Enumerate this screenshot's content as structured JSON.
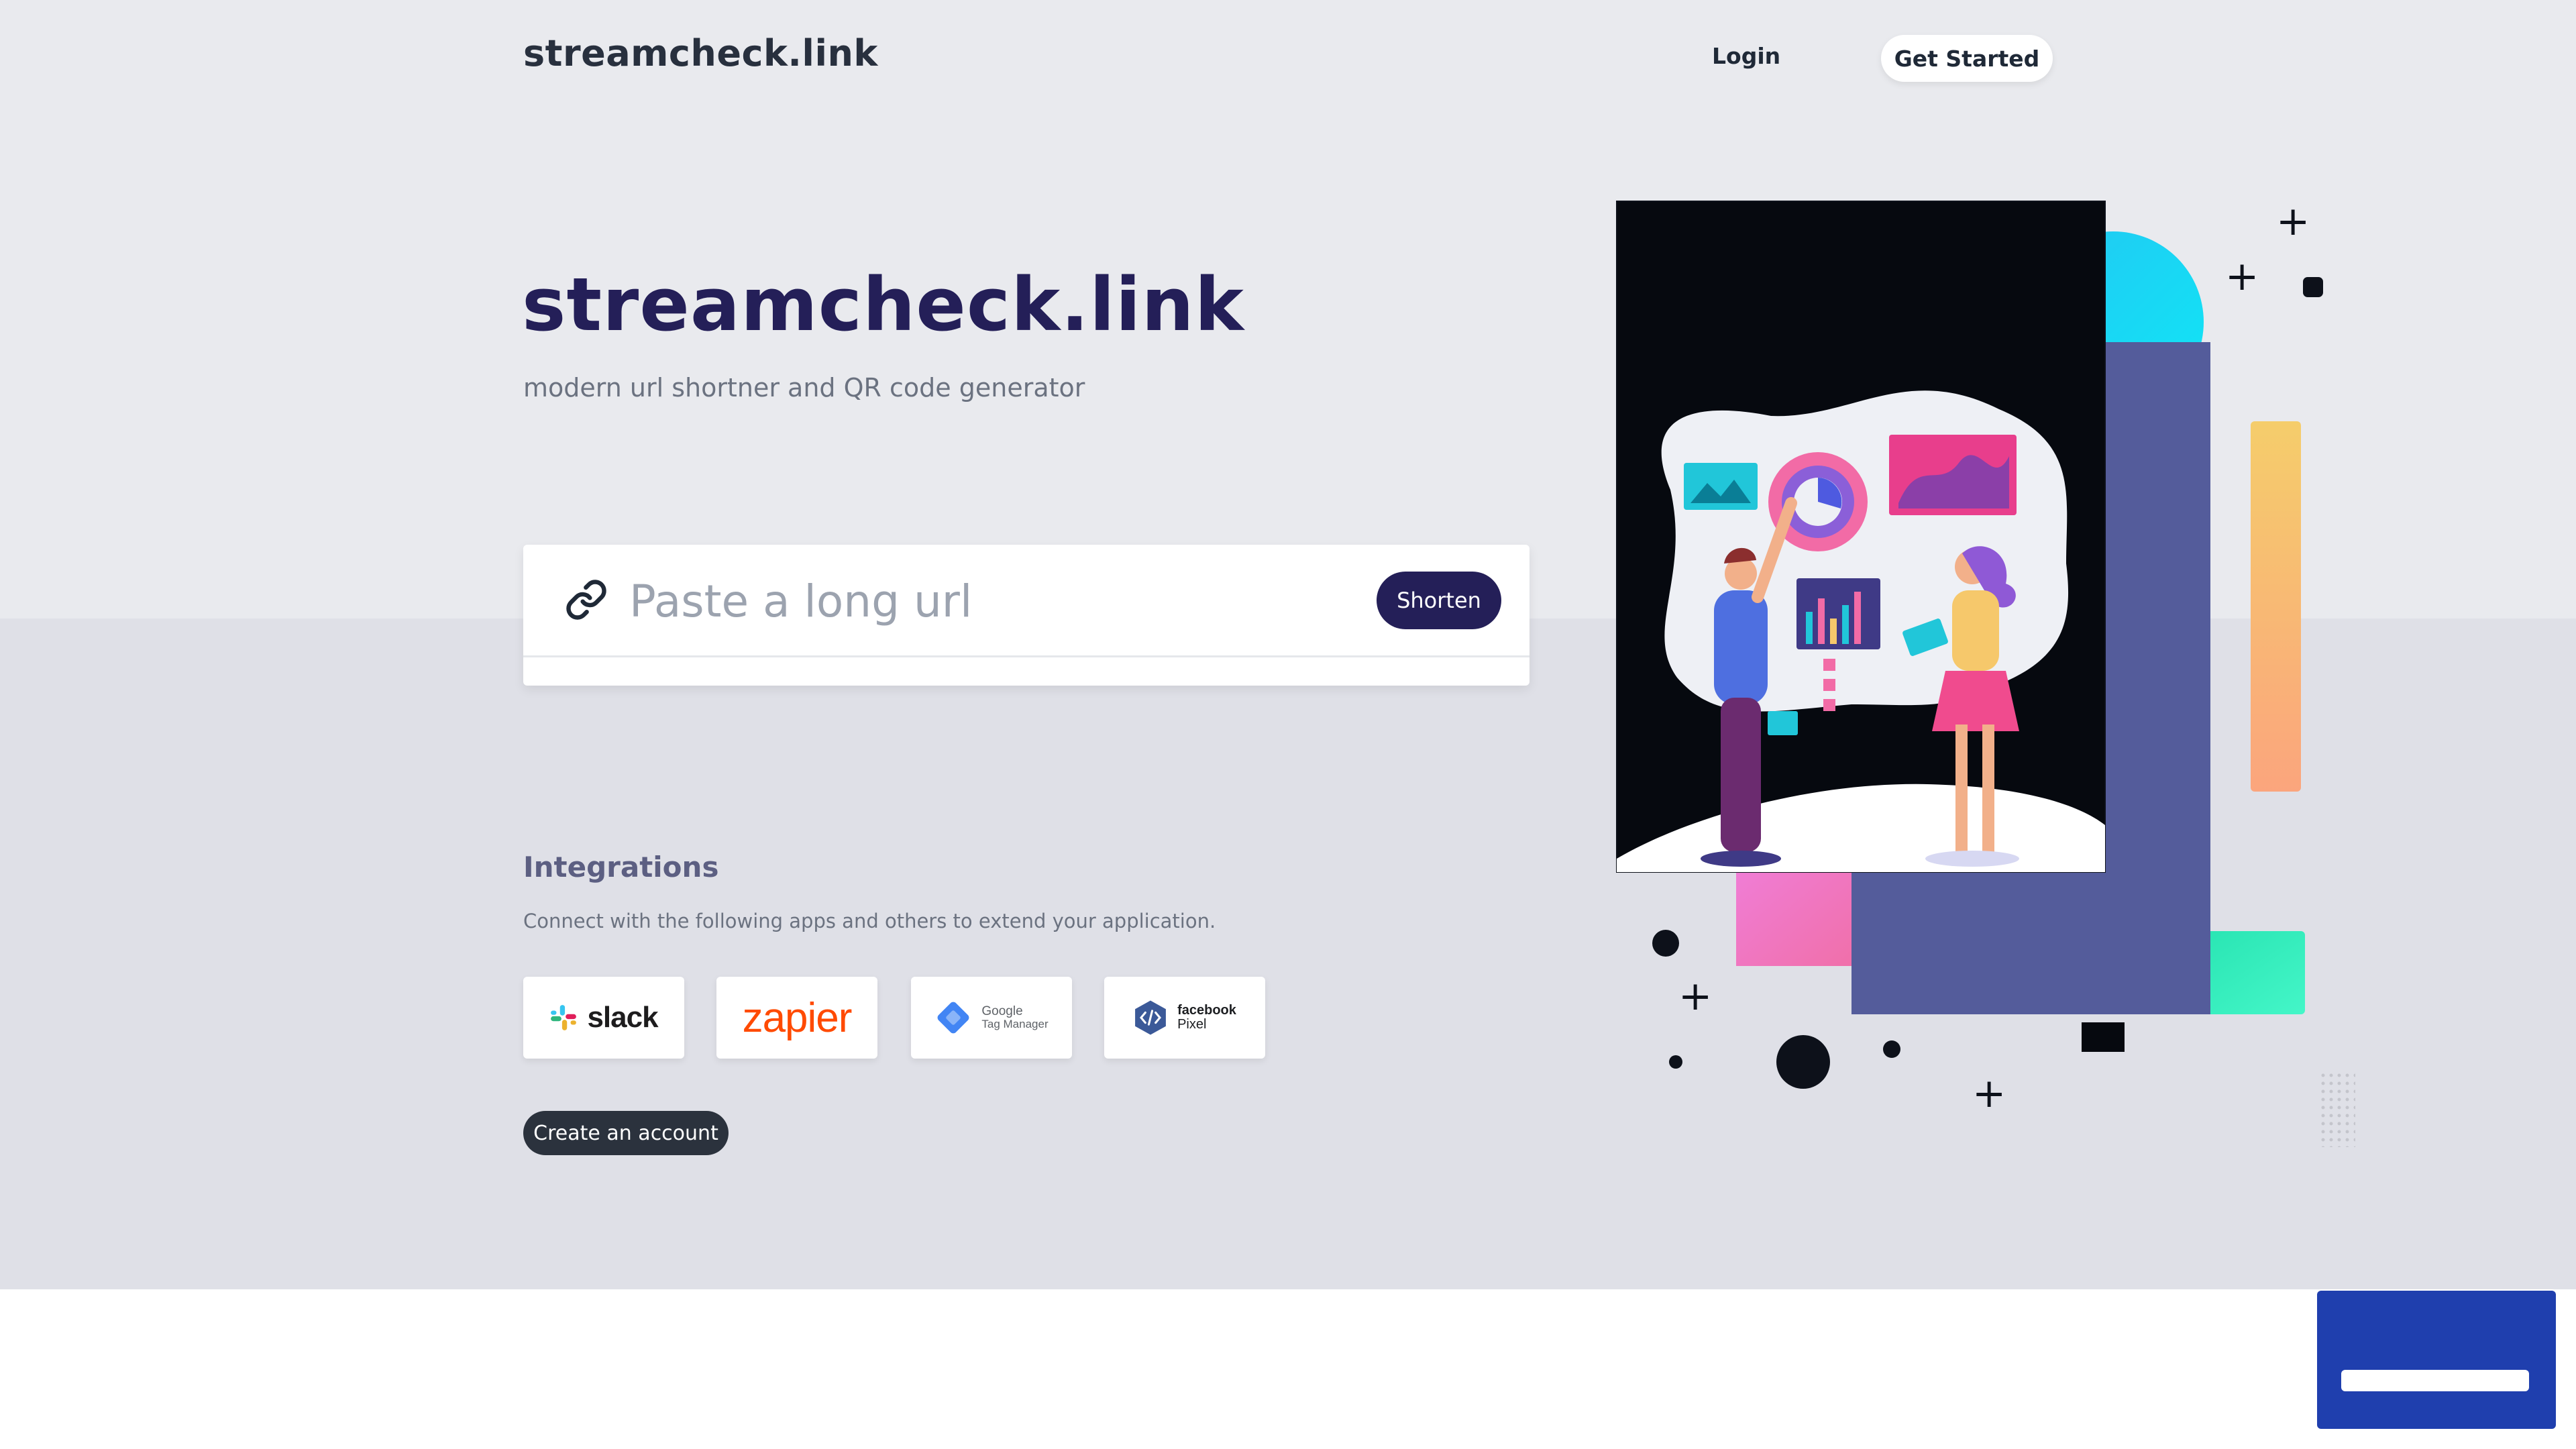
{
  "header": {
    "brand": "streamcheck.link",
    "login_label": "Login",
    "get_started_label": "Get Started"
  },
  "hero": {
    "title": "streamcheck.link",
    "subtitle": "modern url shortner and QR code generator"
  },
  "shortener": {
    "input_value": "",
    "placeholder": "Paste a long url",
    "button_label": "Shorten"
  },
  "integrations": {
    "title": "Integrations",
    "description": "Connect with the following apps and others to extend your application.",
    "logos": {
      "slack": "slack",
      "zapier": "zapier",
      "gtm_line1": "Google",
      "gtm_line2": "Tag Manager",
      "fb_line1": "facebook",
      "fb_line2": "Pixel"
    },
    "create_account_label": "Create an account"
  },
  "icons": {
    "link": "link-icon",
    "chat": "chat-widget-icon"
  },
  "colors": {
    "brand_navy": "#241f58",
    "button_dark": "#2b323d",
    "chat_blue": "#1f3fae"
  }
}
